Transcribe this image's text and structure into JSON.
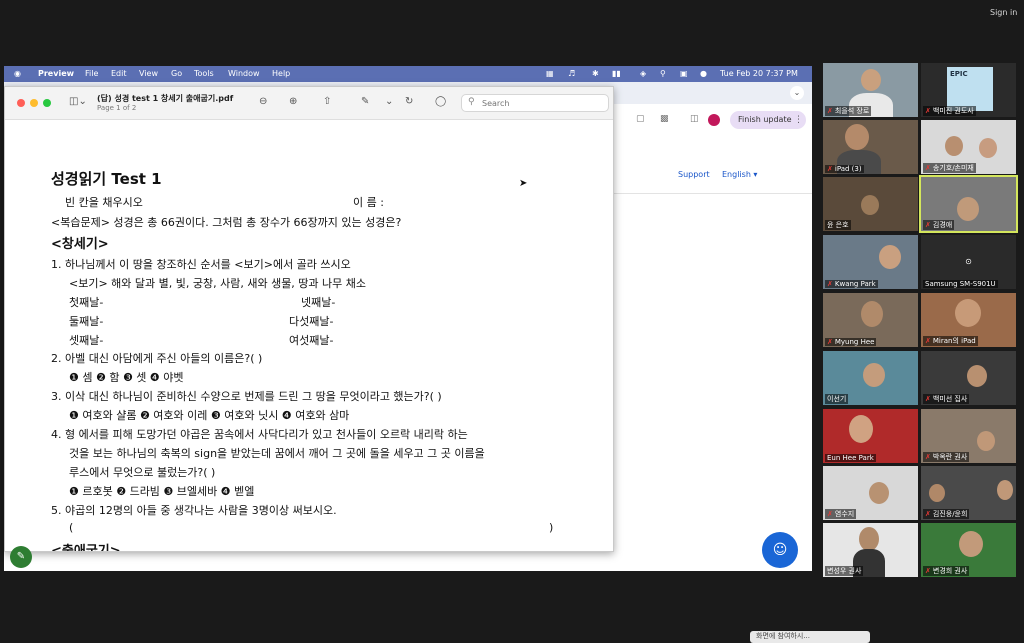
{
  "meeting": {
    "sign_in": "Sign in"
  },
  "mac_menubar": {
    "apple_icon": "apple-icon",
    "items": [
      "Preview",
      "File",
      "Edit",
      "View",
      "Go",
      "Tools",
      "Window",
      "Help"
    ],
    "clock": "Tue Feb 20  7:37 PM"
  },
  "browser": {
    "finish_update": "Finish update",
    "support": "Support",
    "language": "English ▾"
  },
  "preview": {
    "filename": "(답) 성경 test 1 창세기 출애굽기.pdf",
    "page_info": "Page 1 of 2",
    "search_placeholder": "Search"
  },
  "document": {
    "title": "성경읽기 Test 1",
    "instruction": "빈 칸을 채우시오",
    "name_label": "이 름 :",
    "review": "<복습문제> 성경은 총 66권이다. 그처럼 총 장수가 66장까지 있는 성경은?",
    "section1": "<창세기>",
    "lines": [
      "1. 하나님께서 이 땅을 창조하신 순서를 <보기>에서 골라 쓰시오",
      "<보기> 해와 달과 별, 빛, 궁창, 사람, 새와 생물, 땅과 나무 채소",
      "첫째날-",
      "넷째날-",
      "둘째날-",
      "다섯째날-",
      "셋째날-",
      "여섯째날-",
      "2. 아벨 대신 아담에게 주신 아들의 이름은?(          )",
      "❶ 셈   ❷ 함 ❸ 셋 ❹ 야벳",
      "3. 이삭 대신 하나님이 준비하신 수양으로 번제를 드린 그 땅을 무엇이라고 했는가?(           )",
      "❶ 여호와 샬롬 ❷ 여호와 이레 ❸ 여호와 닛시 ❹ 여호와 삼마",
      "4. 형 에서를 피해 도망가던 야곱은 꿈속에서 사닥다리가 있고 천사들이 오르락 내리락 하는",
      "것을 보는 하나님의 축복의 sign을 받았는데 꿈에서 깨어 그 곳에 돌을 세우고 그 곳 이름을",
      "루스에서 무엇으로 불렀는가?(             )",
      "❶ 르호봇 ❷ 드라빔 ❸ 브엘세바 ❹ 벧엘",
      "5. 야곱의 12명의 아들 중 생각나는 사람을 3명이상 써보시오.",
      "(",
      ")"
    ],
    "section2": "<출애굽기>"
  },
  "participants": [
    {
      "name": "최을석 장로",
      "muted": true
    },
    {
      "name": "백미진 권도사",
      "muted": true,
      "has_image": "EPIC"
    },
    {
      "name": "iPad (3)",
      "muted": true
    },
    {
      "name": "송기호/손미재",
      "muted": true
    },
    {
      "name": "윤 은호",
      "muted": false
    },
    {
      "name": "김경애",
      "muted": true,
      "active": true
    },
    {
      "name": "Kwang Park",
      "muted": true
    },
    {
      "name": "Samsung SM-S901U",
      "muted": true
    },
    {
      "name": "Myung Hee",
      "muted": true
    },
    {
      "name": "Miran의 iPad",
      "muted": true
    },
    {
      "name": "이선기",
      "muted": false
    },
    {
      "name": "백미선 집사",
      "muted": true
    },
    {
      "name": "Eun Hee Park",
      "muted": true
    },
    {
      "name": "박옥란 권사",
      "muted": true
    },
    {
      "name": "염수지",
      "muted": true
    },
    {
      "name": "김진웅/윤희",
      "muted": true
    },
    {
      "name": "변성우 권사",
      "muted": false
    },
    {
      "name": "변경희 권사",
      "muted": true
    }
  ],
  "bottom_notice": "화면에 참여하시..."
}
